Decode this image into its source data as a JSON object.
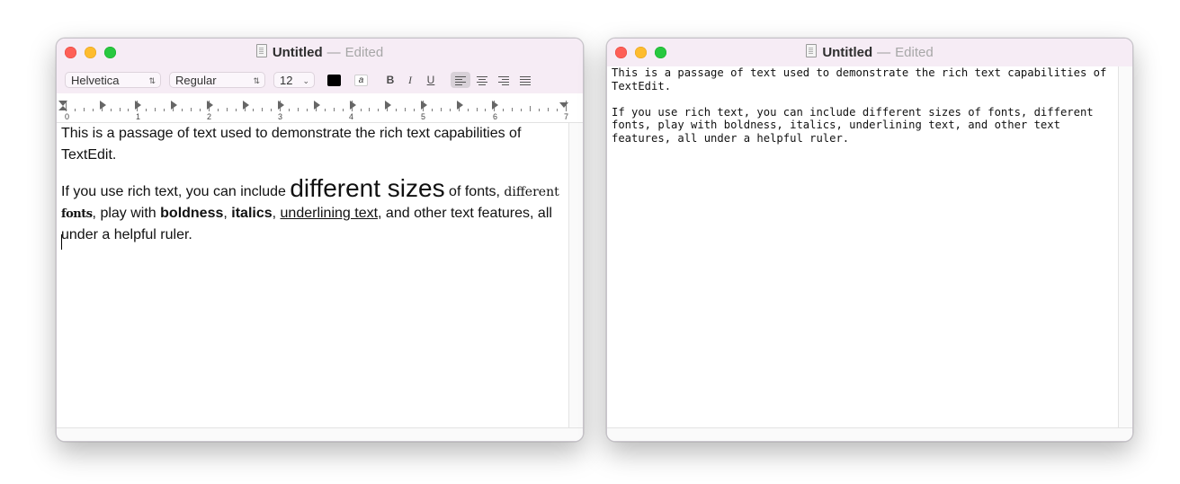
{
  "left_window": {
    "title": "Untitled",
    "separator": "—",
    "status": "Edited",
    "toolbar": {
      "font_family": "Helvetica",
      "font_style": "Regular",
      "font_size": "12",
      "text_color": "#000000",
      "bold_label": "B",
      "italic_label": "I",
      "underline_label": "U"
    },
    "ruler": {
      "numbers": [
        "0",
        "1",
        "2",
        "3",
        "4",
        "5",
        "6",
        "7"
      ]
    },
    "document": {
      "paragraph1": "This is a passage of text used to demonstrate the rich text capabilities of TextEdit.",
      "p2_a": "If you use rich text, you can include ",
      "p2_big": "different sizes",
      "p2_b": " of fonts, ",
      "p2_serif": "different",
      "p2_fancy": "fonts",
      "p2_c": ", play with ",
      "p2_bold": "boldness",
      "p2_d": ", ",
      "p2_italic": "italics",
      "p2_e": ", ",
      "p2_underline": "underlining text",
      "p2_f": ", and other text features, all under a helpful ruler."
    }
  },
  "right_window": {
    "title": "Untitled",
    "separator": "—",
    "status": "Edited",
    "document": {
      "text": "This is a passage of text used to demonstrate the rich text capabilities of\nTextEdit.\n\nIf you use rich text, you can include different sizes of fonts, different\nfonts, play with boldness, italics, underlining text, and other text\nfeatures, all under a helpful ruler."
    }
  },
  "colors": {
    "titlebar": "#f6ecf5",
    "close": "#fe5f57",
    "minimize": "#febc2e",
    "zoom": "#28c840"
  }
}
